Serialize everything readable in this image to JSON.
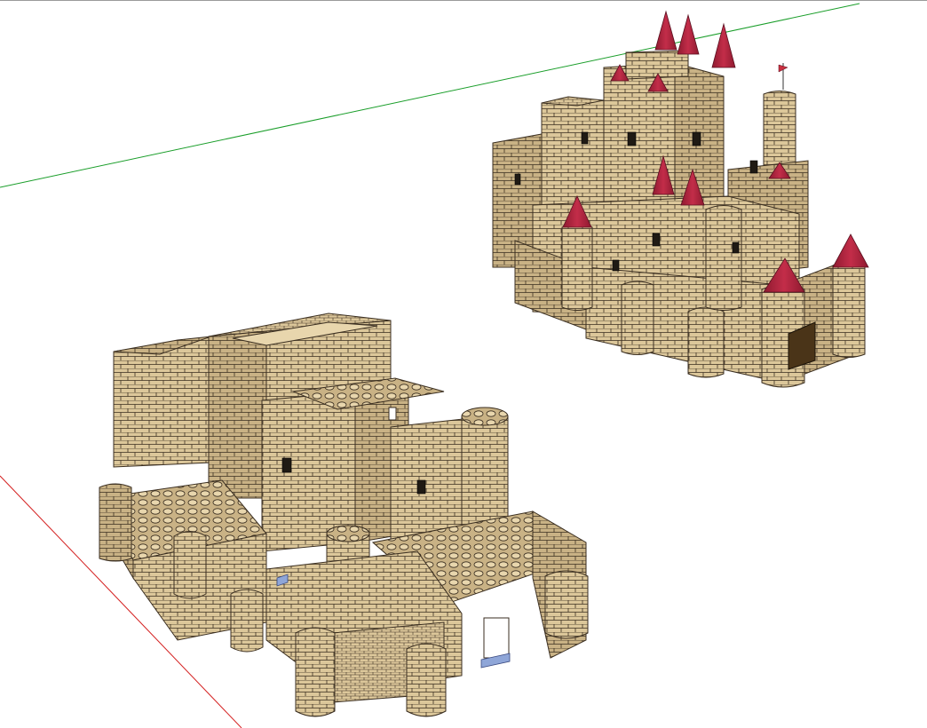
{
  "viewport": {
    "background": "#ffffff",
    "top_border": "#9a9a9a"
  },
  "axes": {
    "green_axis_color": "#1a9e2a",
    "red_axis_color": "#d42020"
  },
  "materials": {
    "stone": "#dcc79a",
    "stone_shade": "#c9b285",
    "stone_light": "#e8d6ad",
    "mortar": "#3a2e20",
    "roof": "#b3253f",
    "roof_shade": "#8f1a30",
    "window": "#1f1a14",
    "door": "#4a3418",
    "selection": "#8fa6d8"
  },
  "icons": {
    "flag": "flag-icon"
  }
}
